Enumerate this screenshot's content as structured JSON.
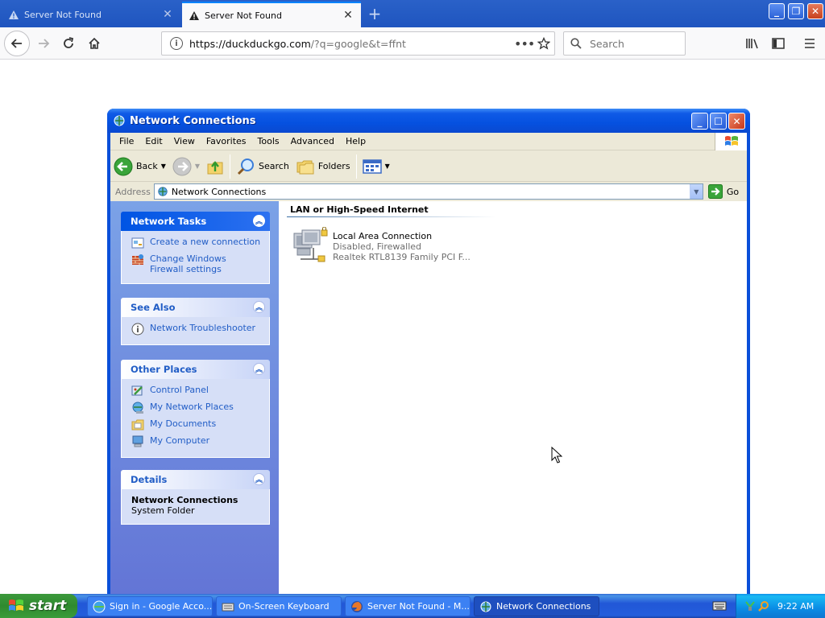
{
  "browser": {
    "tabs": [
      {
        "title": "Server Not Found",
        "active": false
      },
      {
        "title": "Server Not Found",
        "active": true
      }
    ],
    "url": {
      "host": "https://duckduckgo.com",
      "rest": "/?q=google&t=ffnt"
    },
    "search_placeholder": "Search"
  },
  "window": {
    "title": "Network Connections",
    "menu": [
      "File",
      "Edit",
      "View",
      "Favorites",
      "Tools",
      "Advanced",
      "Help"
    ],
    "toolbar": {
      "back": "Back",
      "search": "Search",
      "folders": "Folders"
    },
    "address": {
      "label": "Address",
      "value": "Network Connections",
      "go": "Go"
    },
    "tasks": {
      "network_tasks": {
        "title": "Network Tasks",
        "items": [
          "Create a new connection",
          "Change Windows Firewall settings"
        ]
      },
      "see_also": {
        "title": "See Also",
        "items": [
          "Network Troubleshooter"
        ]
      },
      "other_places": {
        "title": "Other Places",
        "items": [
          "Control Panel",
          "My Network Places",
          "My Documents",
          "My Computer"
        ]
      },
      "details": {
        "title": "Details",
        "name": "Network Connections",
        "type": "System Folder"
      }
    },
    "content": {
      "group": "LAN or High-Speed Internet",
      "connection": {
        "name": "Local Area Connection",
        "status": "Disabled, Firewalled",
        "device": "Realtek RTL8139 Family PCI F..."
      }
    }
  },
  "taskbar": {
    "start": "start",
    "buttons": [
      {
        "label": "Sign in - Google Acco...",
        "active": false
      },
      {
        "label": "On-Screen Keyboard",
        "active": false
      },
      {
        "label": "Server Not Found - M...",
        "active": false
      },
      {
        "label": "Network Connections",
        "active": true
      }
    ],
    "clock": "9:22 AM"
  },
  "colors": {
    "xp_blue": "#0054e3",
    "link_blue": "#215dc6",
    "start_green": "#3c9a3c",
    "firefox_accent": "#0a84ff"
  }
}
